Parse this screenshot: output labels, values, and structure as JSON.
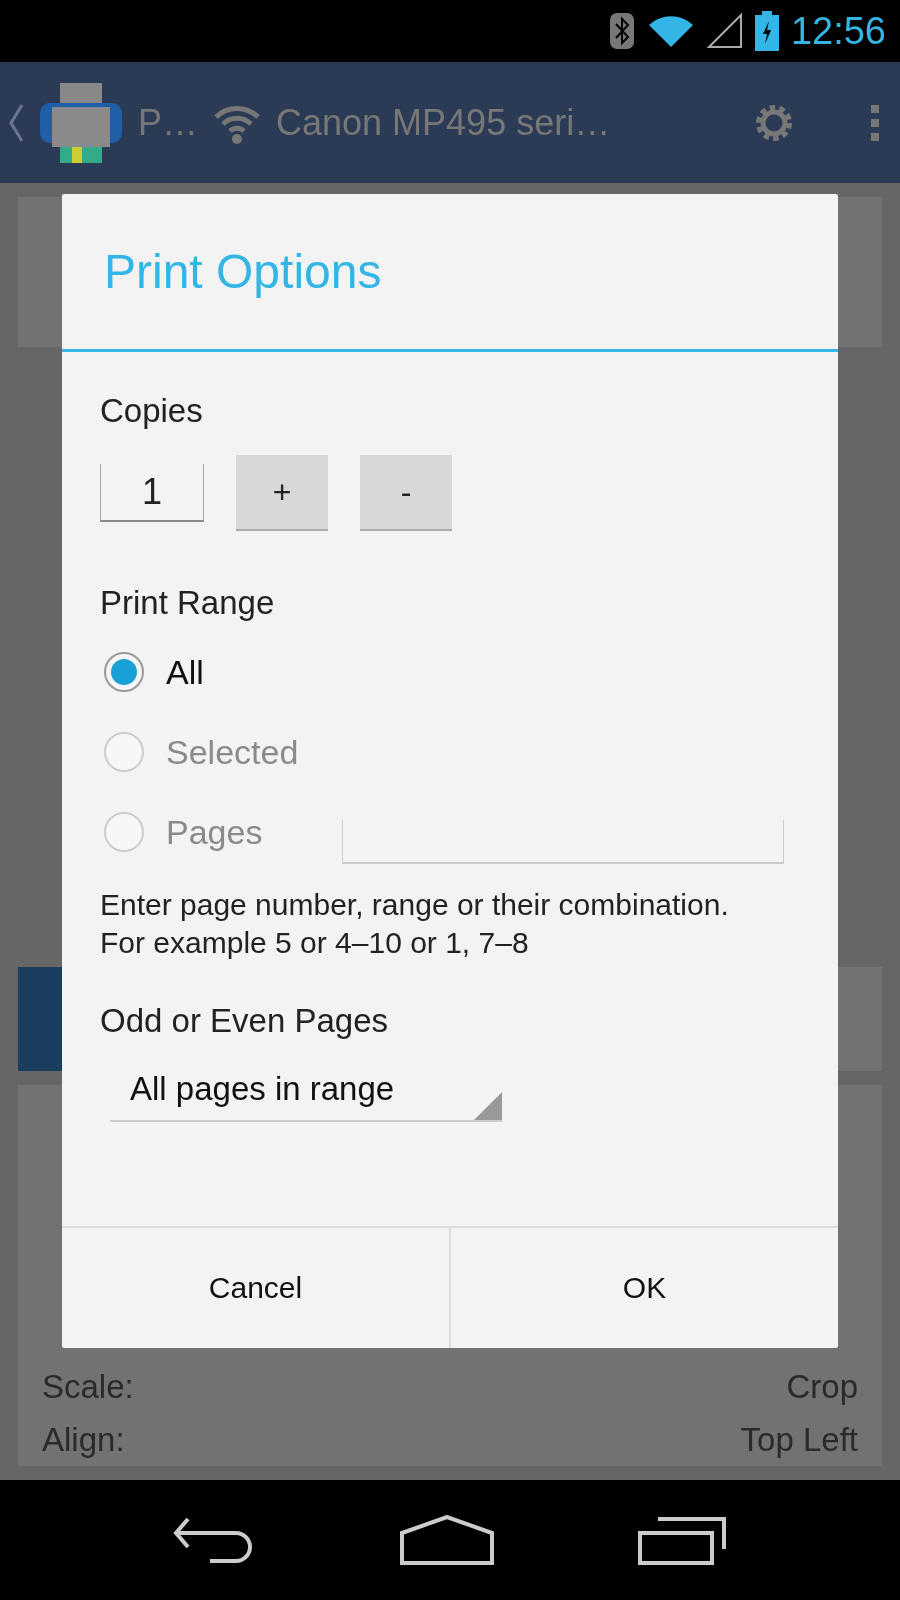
{
  "status_bar": {
    "time": "12:56"
  },
  "action_bar": {
    "app_title": "P…",
    "printer_name": "Canon MP495 seri…"
  },
  "background": {
    "rows": [
      {
        "label": "Scale:",
        "value": "Crop"
      },
      {
        "label": "Align:",
        "value": "Top Left"
      }
    ]
  },
  "dialog": {
    "title": "Print Options",
    "copies": {
      "label": "Copies",
      "value": "1",
      "increment": "+",
      "decrement": "-"
    },
    "print_range": {
      "label": "Print Range",
      "options": [
        {
          "label": "All",
          "selected": true,
          "disabled": false,
          "kind": "plain"
        },
        {
          "label": "Selected",
          "selected": false,
          "disabled": true,
          "kind": "plain"
        },
        {
          "label": "Pages",
          "selected": false,
          "disabled": true,
          "kind": "field"
        }
      ],
      "hint": "Enter page number, range or their combination. For example 5 or 4–10 or 1, 7–8"
    },
    "odd_even": {
      "label": "Odd or Even Pages",
      "value": "All pages in range"
    },
    "buttons": [
      "Cancel",
      "OK"
    ]
  }
}
